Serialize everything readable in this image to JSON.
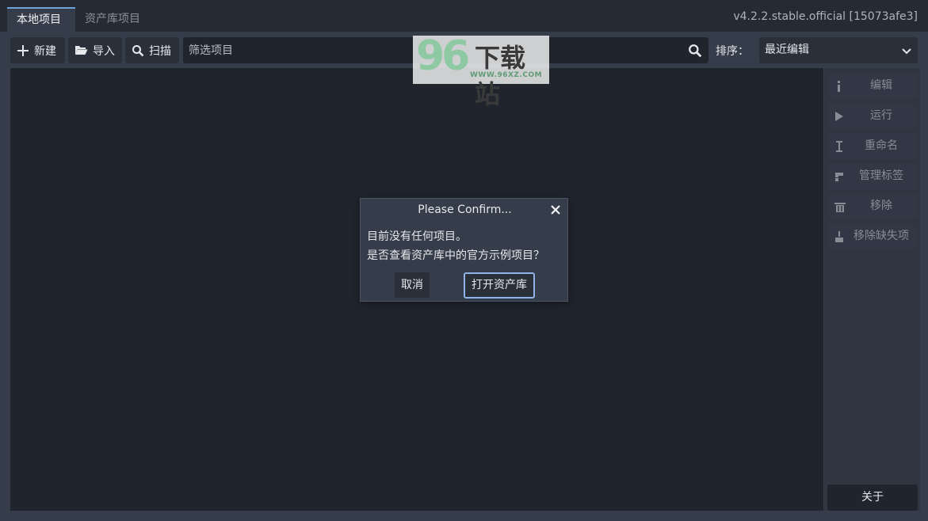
{
  "tabs": [
    {
      "label": "本地项目"
    },
    {
      "label": "资产库项目"
    }
  ],
  "version": "v4.2.2.stable.official [15073afe3]",
  "toolbar": {
    "new_label": "新建",
    "import_label": "导入",
    "scan_label": "扫描",
    "filter_placeholder": "筛选项目",
    "sort_label": "排序：",
    "sort_value": "最近编辑"
  },
  "side_buttons": {
    "edit": "编辑",
    "run": "运行",
    "rename": "重命名",
    "manage_tags": "管理标签",
    "remove": "移除",
    "remove_missing": "移除缺失项",
    "about": "关于"
  },
  "dialog": {
    "title": "Please Confirm...",
    "message_line1": "目前没有任何项目。",
    "message_line2": "是否查看资产库中的官方示例项目？",
    "cancel_label": "取消",
    "confirm_label": "打开资产库"
  },
  "watermark": {
    "logo_number": "96",
    "logo_text": "下载站",
    "url": "WWW.96XZ.COM"
  },
  "colors": {
    "accent": "#6fa3d8",
    "background": "#363d4a",
    "panel": "#20252d"
  }
}
